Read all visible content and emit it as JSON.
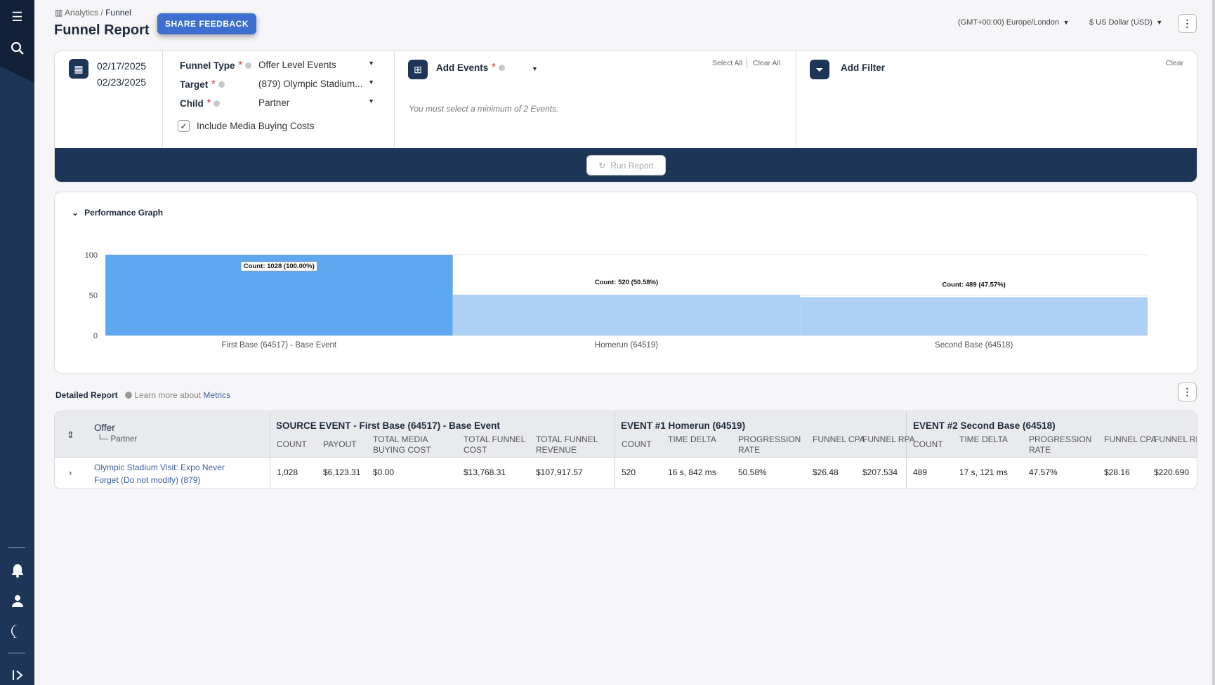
{
  "sidebar": {
    "icons": [
      "menu-icon",
      "search-icon",
      "bell-icon",
      "user-icon",
      "help-icon",
      "expand-icon"
    ]
  },
  "breadcrumb": {
    "section": "Analytics",
    "separator": "/",
    "page": "Funnel"
  },
  "header": {
    "title": "Funnel Report",
    "share_feedback": "SHARE FEEDBACK",
    "timezone": "(GMT+00:00) Europe/London",
    "currency": "$ US Dollar (USD)"
  },
  "filters": {
    "date_start": "02/17/2025",
    "date_end": "02/23/2025",
    "funnel_type_label": "Funnel Type",
    "funnel_type_value": "Offer Level Events",
    "target_label": "Target",
    "target_value": "(879) Olympic Stadium...",
    "child_label": "Child",
    "child_value": "Partner",
    "include_media_label": "Include Media Buying Costs",
    "include_media_checked": true,
    "required_mark": "*",
    "add_events_label": "Add Events",
    "select_all": "Select All",
    "clear_all": "Clear All",
    "events_hint": "You must select a minimum of 2 Events.",
    "add_filter_label": "Add Filter",
    "clear": "Clear",
    "run_report": "Run Report"
  },
  "graph": {
    "title": "Performance Graph"
  },
  "chart_data": {
    "type": "bar",
    "categories": [
      "First Base (64517) - Base Event",
      "Homerun (64519)",
      "Second Base (64518)"
    ],
    "values": [
      100,
      50.58,
      47.57
    ],
    "data_labels": [
      "Count: 1028 (100.00%)",
      "Count: 520 (50.58%)",
      "Count: 489 (47.57%)"
    ],
    "counts": [
      1028,
      520,
      489
    ],
    "ylim": [
      0,
      100
    ],
    "yticks": [
      "0",
      "50",
      "100"
    ],
    "grid": true,
    "colors": [
      "#5ea8ef",
      "#afd0f5",
      "#afd0f5"
    ]
  },
  "report": {
    "title": "Detailed Report",
    "learn_more": "Learn more about",
    "metrics_link": "Metrics"
  },
  "table": {
    "offer_header": "Offer",
    "partner_header": "Partner",
    "groups": [
      {
        "title": "SOURCE EVENT - First Base (64517) - Base Event",
        "columns": [
          "COUNT",
          "PAYOUT",
          "TOTAL MEDIA BUYING COST",
          "TOTAL FUNNEL COST",
          "TOTAL FUNNEL REVENUE"
        ]
      },
      {
        "title": "EVENT #1 Homerun (64519)",
        "columns": [
          "COUNT",
          "TIME DELTA",
          "PROGRESSION RATE",
          "FUNNEL CPA",
          "FUNNEL RPA"
        ]
      },
      {
        "title": "EVENT #2 Second Base (64518)",
        "columns": [
          "COUNT",
          "TIME DELTA",
          "PROGRESSION RATE",
          "FUNNEL CPA",
          "FUNNEL RPA"
        ]
      }
    ],
    "rows": [
      {
        "offer": "Olympic Stadium Visit: Expo Never Forget (Do not modify) (879)",
        "values": [
          "1,028",
          "$6,123.31",
          "$0.00",
          "$13,768.31",
          "$107,917.57",
          "520",
          "16 s, 842 ms",
          "50.58%",
          "$26.48",
          "$207.534",
          "489",
          "17 s, 121 ms",
          "47.57%",
          "$28.16",
          "$220.690"
        ]
      }
    ]
  }
}
